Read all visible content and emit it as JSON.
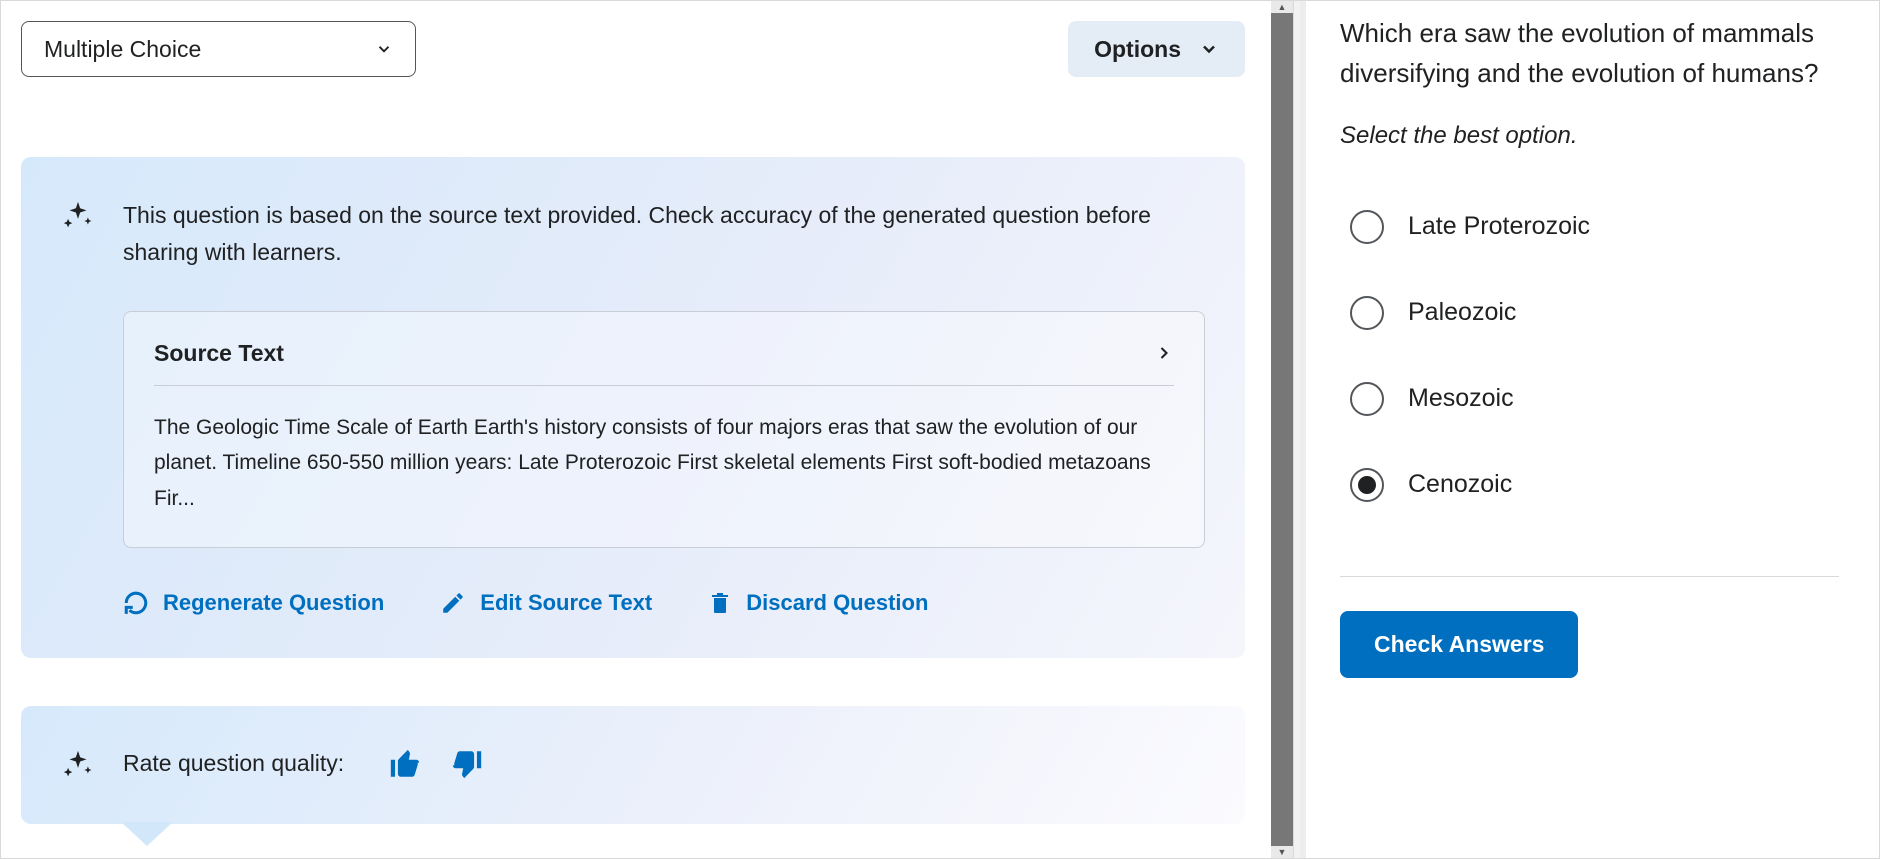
{
  "left": {
    "question_type": "Multiple Choice",
    "options_button": "Options",
    "ai_message": "This question is based on the source text provided. Check accuracy of the generated question before sharing with learners.",
    "source": {
      "title": "Source Text",
      "body": "The Geologic Time Scale of Earth Earth's history consists of four majors eras that saw the evolution of our planet. Timeline 650-550 million years: Late Proterozoic First skeletal elements First soft-bodied metazoans Fir..."
    },
    "actions": {
      "regenerate": "Regenerate Question",
      "edit_source": "Edit Source Text",
      "discard": "Discard Question"
    },
    "rate_label": "Rate question quality:"
  },
  "right": {
    "question": "Which era saw the evolution of mammals diversifying and the evolution of humans?",
    "instruction": "Select the best option.",
    "options": [
      {
        "label": "Late Proterozoic",
        "selected": false
      },
      {
        "label": "Paleozoic",
        "selected": false
      },
      {
        "label": "Mesozoic",
        "selected": false
      },
      {
        "label": "Cenozoic",
        "selected": true
      }
    ],
    "check_button": "Check Answers"
  }
}
